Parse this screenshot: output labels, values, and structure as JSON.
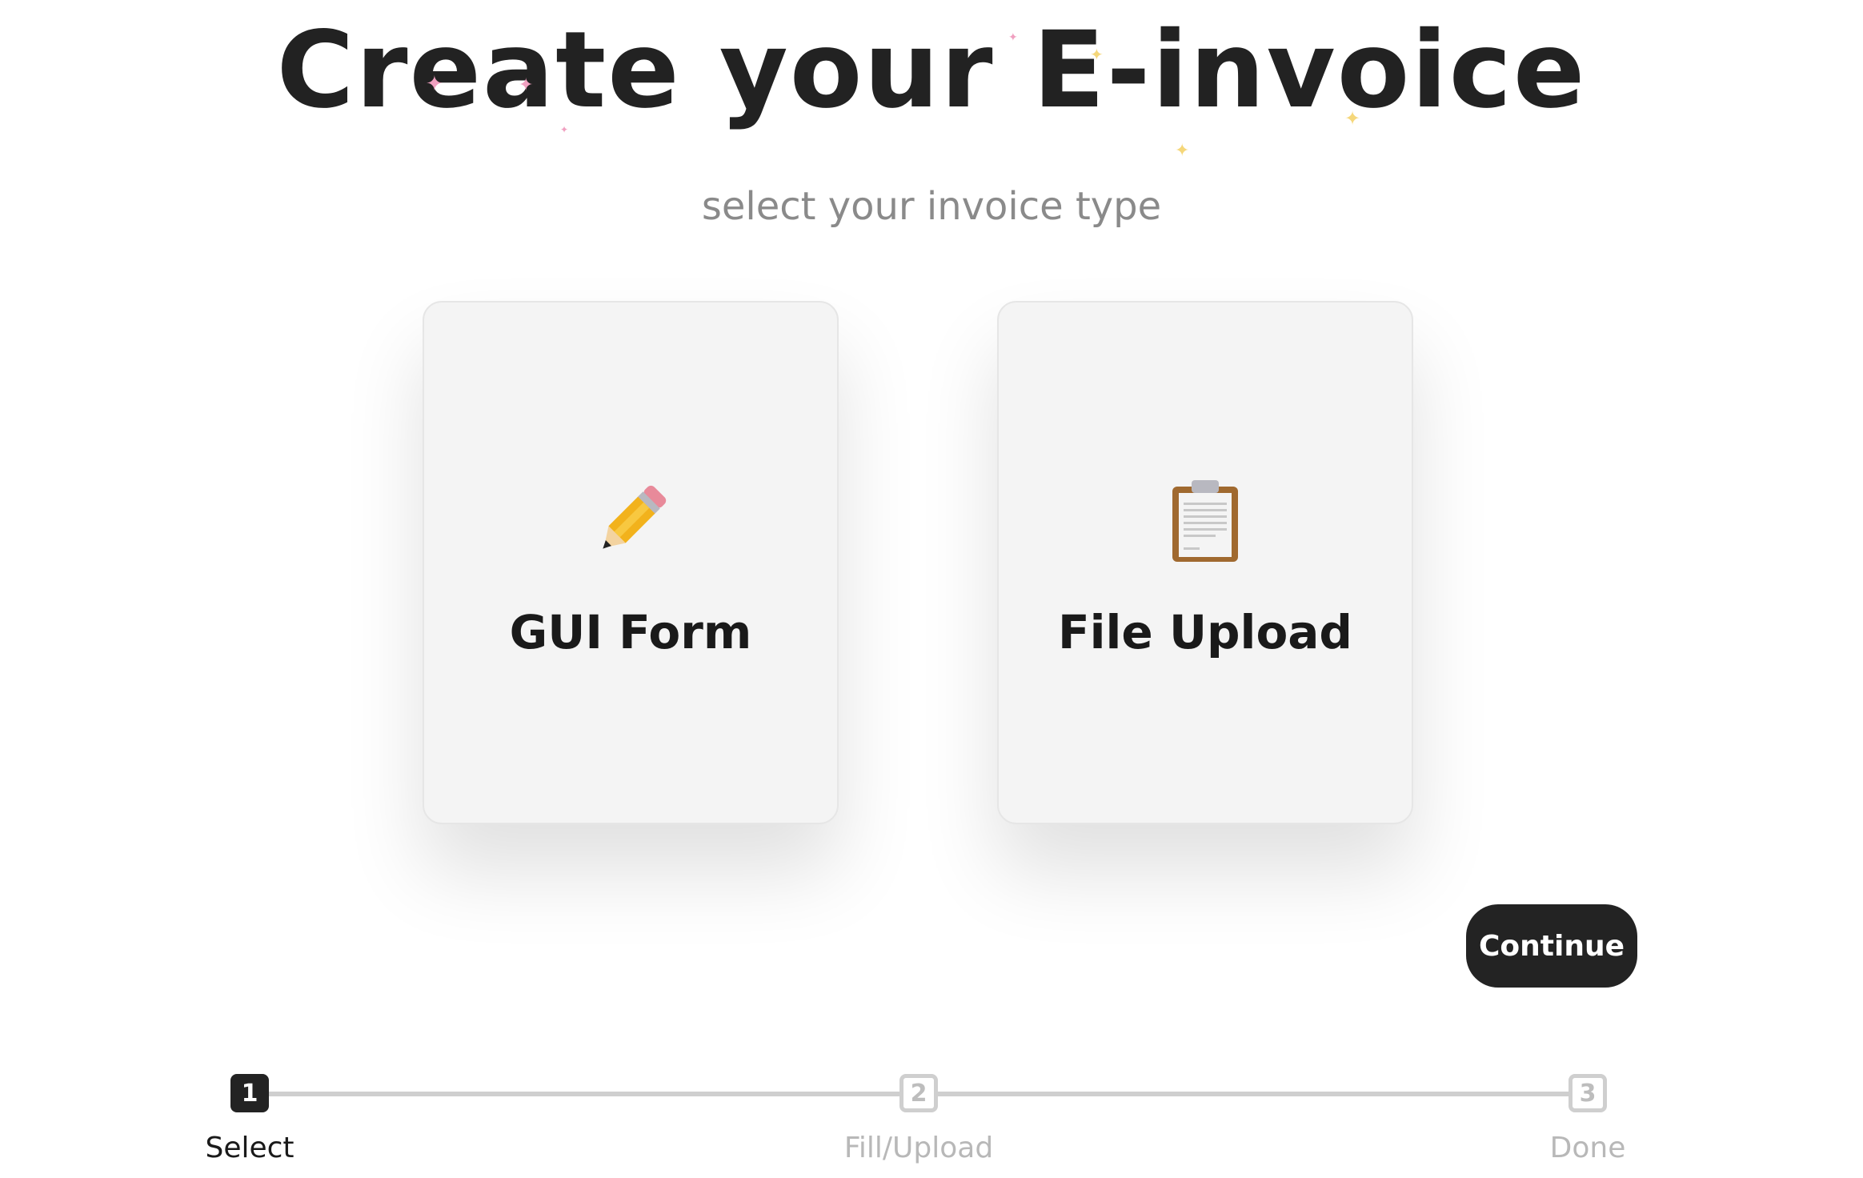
{
  "header": {
    "title": "Create your E-invoice",
    "subtitle": "select your invoice type"
  },
  "options": [
    {
      "label": "GUI Form",
      "icon": "pencil-icon"
    },
    {
      "label": "File Upload",
      "icon": "clipboard-icon"
    }
  ],
  "actions": {
    "continue_label": "Continue"
  },
  "stepper": {
    "steps": [
      {
        "number": "1",
        "label": "Select",
        "state": "active"
      },
      {
        "number": "2",
        "label": "Fill/Upload",
        "state": "inactive"
      },
      {
        "number": "3",
        "label": "Done",
        "state": "inactive"
      }
    ]
  },
  "colors": {
    "primary": "#232323",
    "card_bg": "#f4f4f4",
    "muted_text": "#8a8a8a",
    "sparkle_pink": "#f0a0c0",
    "sparkle_yellow": "#f5d77a"
  }
}
